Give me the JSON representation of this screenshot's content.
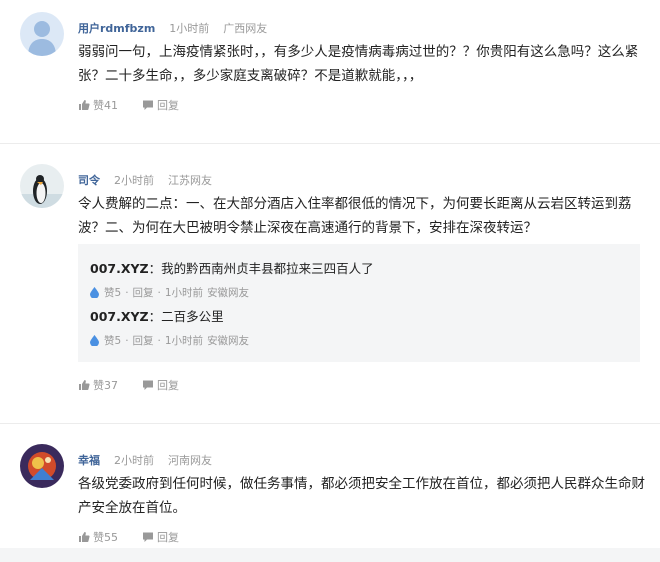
{
  "comments": [
    {
      "user": "用户rdmfbzm",
      "time": "1小时前",
      "location": "广西网友",
      "text": "弱弱问一句，上海疫情紧张时，，有多少人是疫情病毒病过世的？？你贵阳有这么急吗？这么紧张？二十多生命，，多少家庭支离破碎？不是道歉就能，，，",
      "likes": "赞41",
      "reply_label": "回复"
    },
    {
      "user": "司令",
      "time": "2小时前",
      "location": "江苏网友",
      "text": "令人费解的二点：一、在大部分酒店入住率都很低的情况下，为何要长距离从云岩区转运到荔波？二、为何在大巴被明令禁止深夜在高速通行的背景下，安排在深夜转运？",
      "likes": "赞37",
      "reply_label": "回复",
      "replies": [
        {
          "user": "007.XYZ",
          "text": "我的黔西南州贞丰县都拉来三四百人了",
          "likes": "赞5",
          "reply_label": "回复",
          "time": "1小时前",
          "location": "安徽网友"
        },
        {
          "user": "007.XYZ",
          "text": "二百多公里",
          "likes": "赞5",
          "reply_label": "回复",
          "time": "1小时前",
          "location": "安徽网友"
        }
      ]
    },
    {
      "user": "幸福",
      "time": "2小时前",
      "location": "河南网友",
      "text": "各级党委政府到任何时候，做任务事情，都必须把安全工作放在首位，都必须把人民群众生命财产安全放在首位。",
      "likes": "赞55",
      "reply_label": "回复"
    }
  ],
  "colors": {
    "username": "#406599",
    "meta": "#999999",
    "reply_bg": "#f4f5f6",
    "drop": "#4a90e2"
  }
}
